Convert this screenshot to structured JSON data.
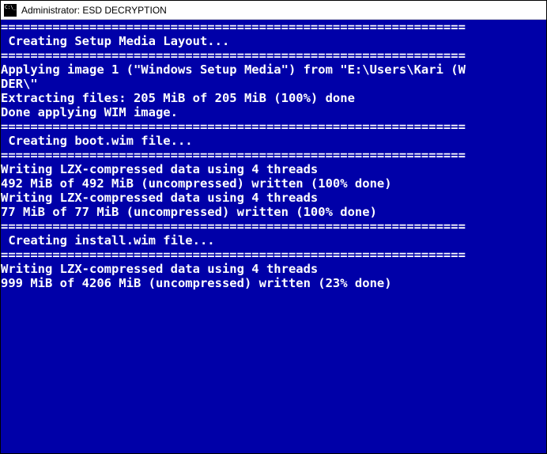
{
  "window": {
    "title": "Administrator:  ESD DECRYPTION"
  },
  "console": {
    "lines": [
      "",
      "===============================================================",
      " Creating Setup Media Layout...",
      "===============================================================",
      "",
      "Applying image 1 (\"Windows Setup Media\") from \"E:\\Users\\Kari (W",
      "DER\\\"",
      "Extracting files: 205 MiB of 205 MiB (100%) done",
      "Done applying WIM image.",
      "",
      "===============================================================",
      " Creating boot.wim file...",
      "===============================================================",
      "",
      "Writing LZX-compressed data using 4 threads",
      "492 MiB of 492 MiB (uncompressed) written (100% done)",
      "",
      "Writing LZX-compressed data using 4 threads",
      "77 MiB of 77 MiB (uncompressed) written (100% done)",
      "",
      "===============================================================",
      " Creating install.wim file...",
      "===============================================================",
      "",
      "Writing LZX-compressed data using 4 threads",
      "999 MiB of 4206 MiB (uncompressed) written (23% done)",
      ""
    ]
  }
}
